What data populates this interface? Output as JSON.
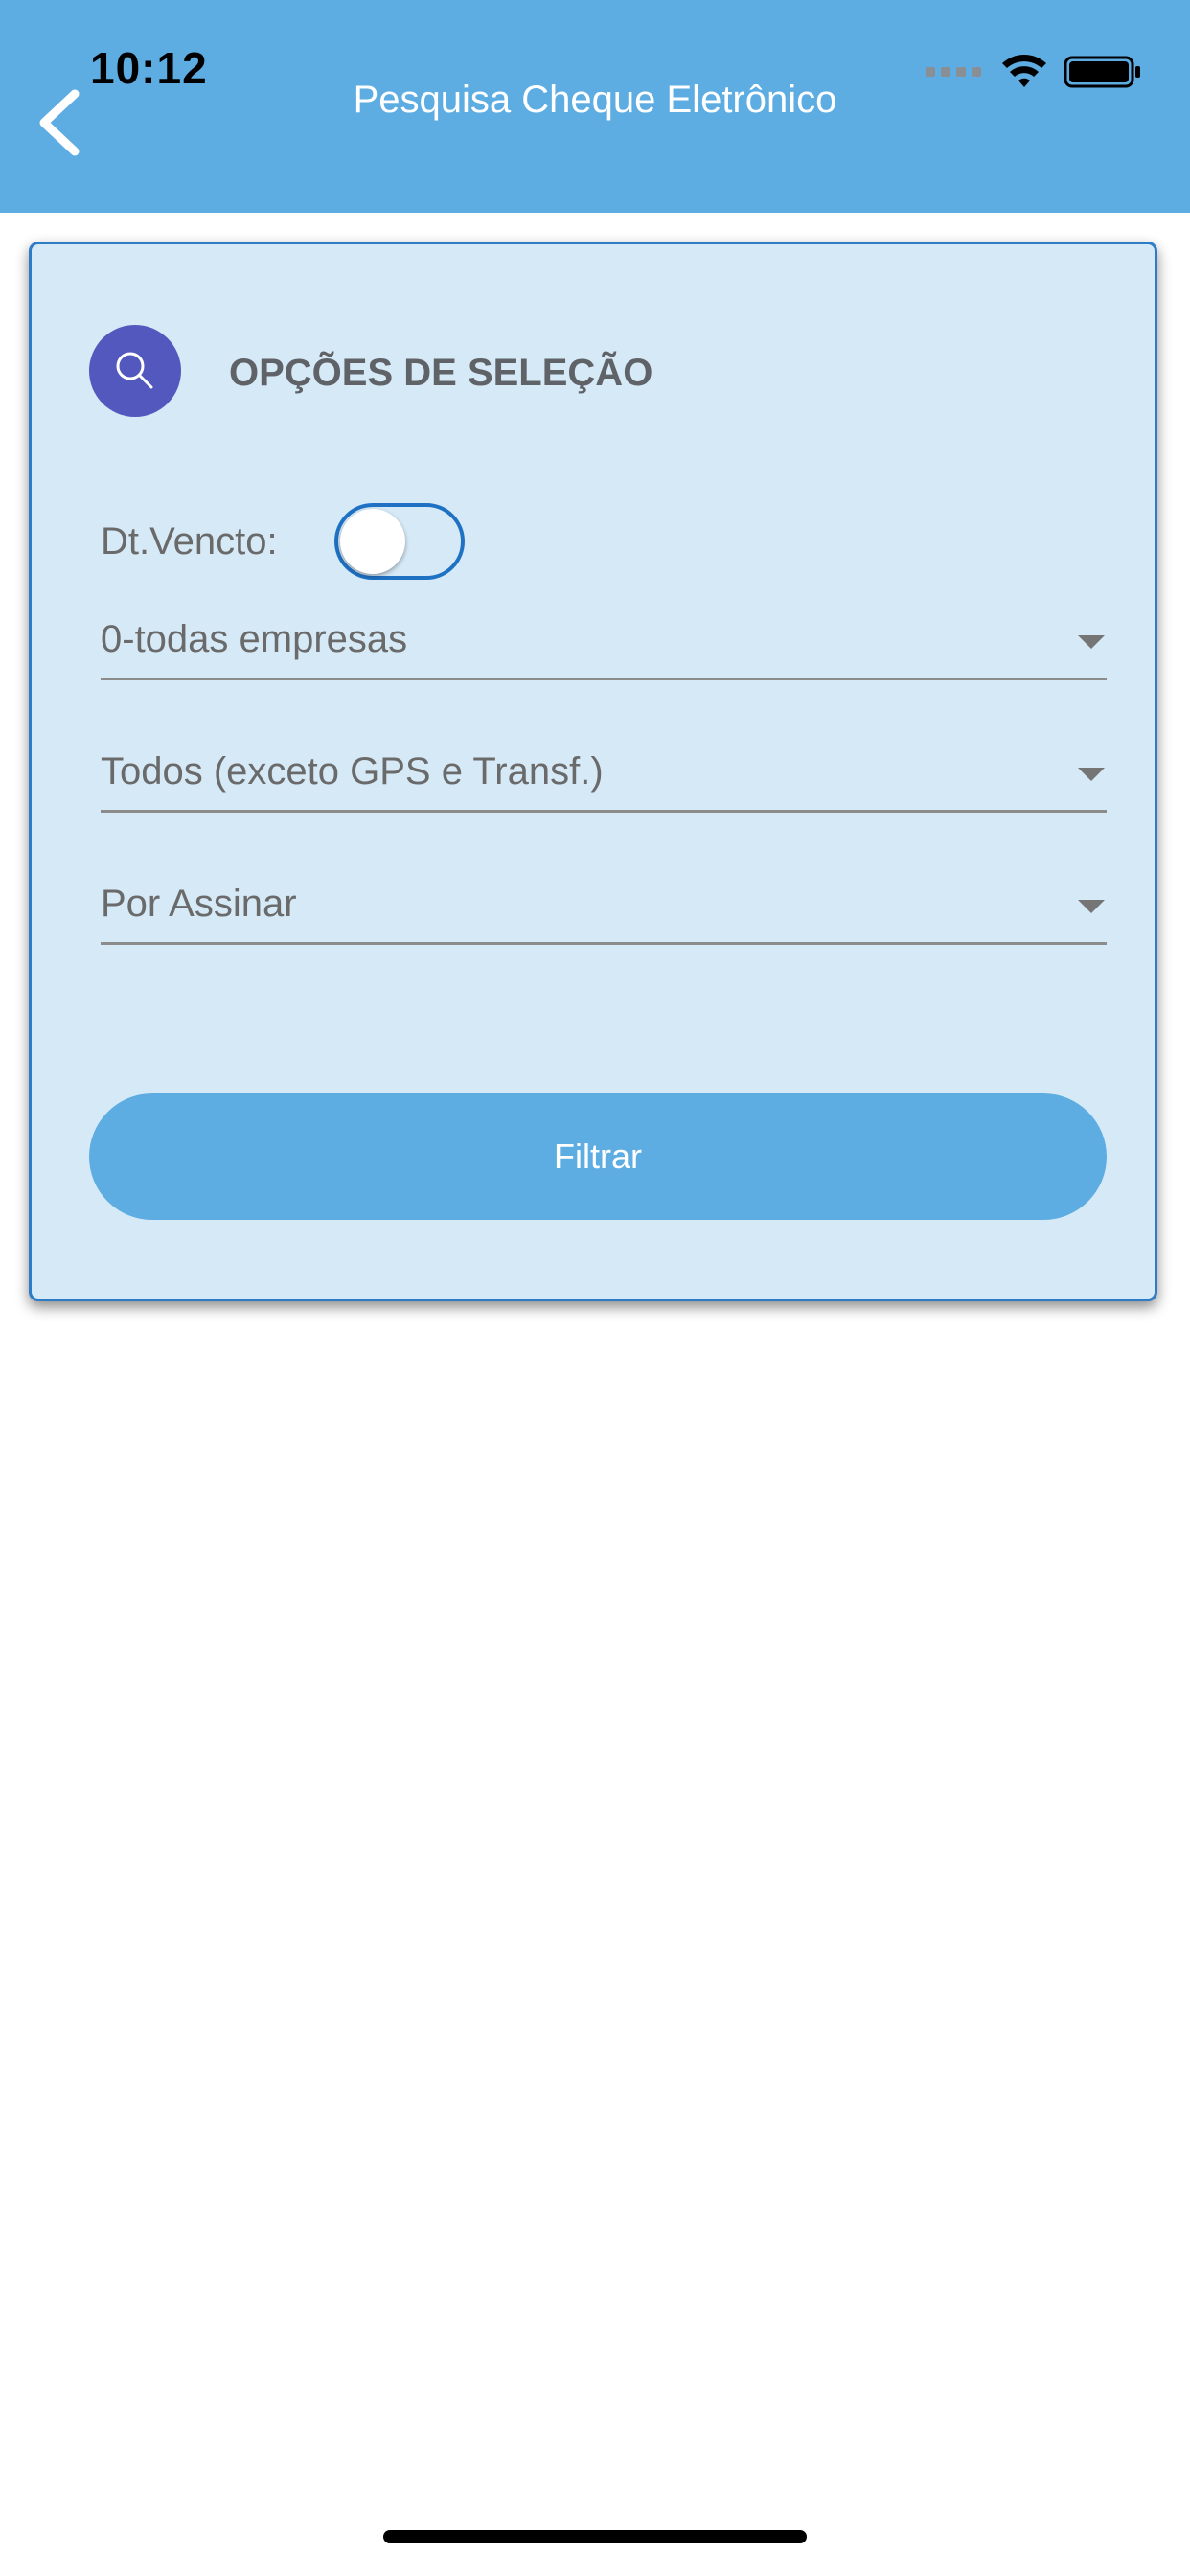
{
  "status_bar": {
    "time": "10:12",
    "icons": [
      "signal-icon",
      "wifi-icon",
      "battery-icon"
    ]
  },
  "header": {
    "title": "Pesquisa Cheque Eletrônico",
    "back_icon": "chevron-left-icon",
    "background": "#5DADE2"
  },
  "card": {
    "title": "OPÇÕES DE SELEÇÃO",
    "icon": "search-icon",
    "icon_color": "#5258BE",
    "background": "#D6E9F7",
    "border_color": "#2E7BC6"
  },
  "dt_vencto": {
    "label": "Dt.Vencto:",
    "enabled": false
  },
  "selects": {
    "empresa": {
      "value": "0-todas empresas"
    },
    "tipo": {
      "value": "Todos (exceto GPS e Transf.)"
    },
    "status": {
      "value": "Por Assinar"
    }
  },
  "filter_button": {
    "label": "Filtrar"
  }
}
